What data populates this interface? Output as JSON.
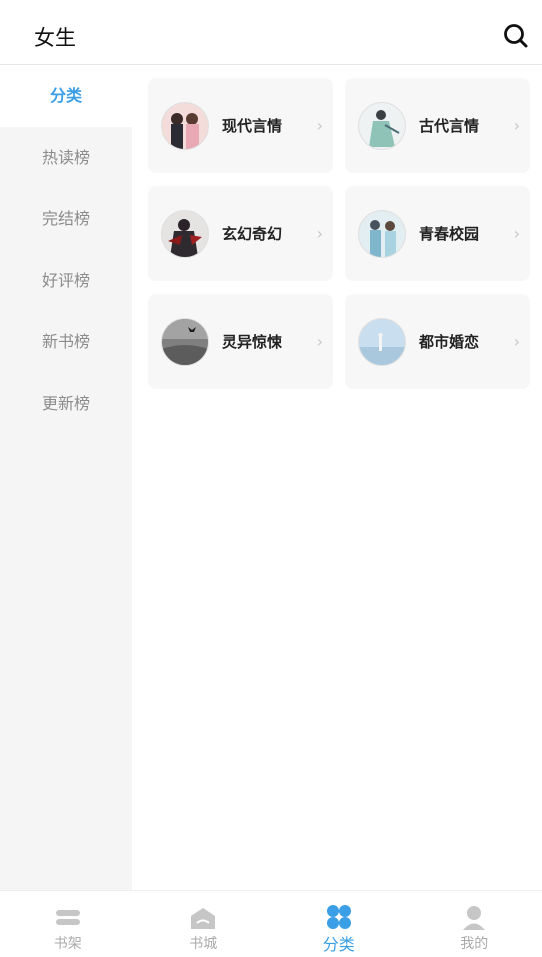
{
  "header": {
    "title": "女生"
  },
  "sidebar": {
    "items": [
      {
        "label": "分类"
      },
      {
        "label": "热读榜"
      },
      {
        "label": "完结榜"
      },
      {
        "label": "好评榜"
      },
      {
        "label": "新书榜"
      },
      {
        "label": "更新榜"
      }
    ]
  },
  "categories": [
    {
      "label": "现代言情",
      "icon": "chevron-right"
    },
    {
      "label": "古代言情",
      "icon": "chevron-right"
    },
    {
      "label": "玄幻奇幻",
      "icon": "chevron-right"
    },
    {
      "label": "青春校园",
      "icon": "chevron-right"
    },
    {
      "label": "灵异惊悚",
      "icon": "chevron-right"
    },
    {
      "label": "都市婚恋",
      "icon": "chevron-right"
    }
  ],
  "tabbar": {
    "tabs": [
      {
        "label": "书架"
      },
      {
        "label": "书城"
      },
      {
        "label": "分类"
      },
      {
        "label": "我的"
      }
    ]
  },
  "colors": {
    "accent": "#3a9fe6",
    "inactive": "#aaaaaa"
  }
}
